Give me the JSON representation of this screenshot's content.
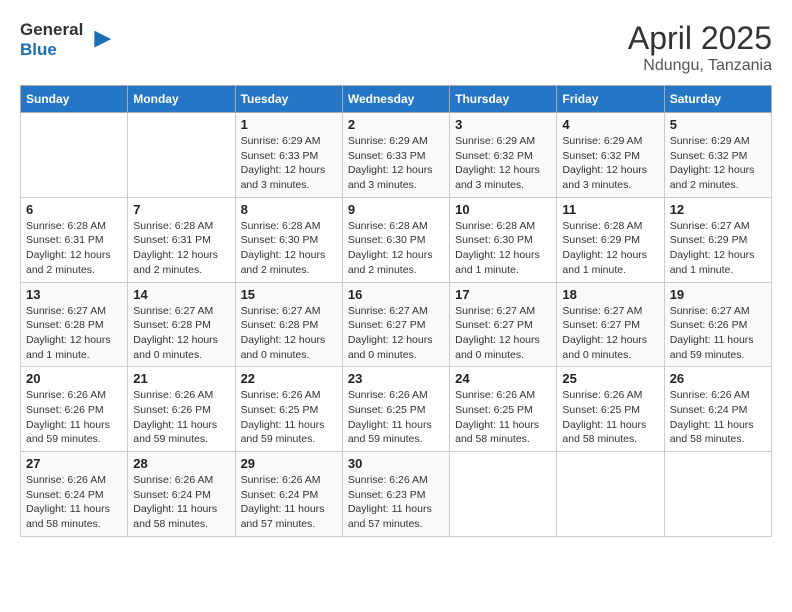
{
  "logo": {
    "general": "General",
    "blue": "Blue"
  },
  "title": "April 2025",
  "subtitle": "Ndungu, Tanzania",
  "days_of_week": [
    "Sunday",
    "Monday",
    "Tuesday",
    "Wednesday",
    "Thursday",
    "Friday",
    "Saturday"
  ],
  "weeks": [
    [
      {
        "date": "",
        "info": ""
      },
      {
        "date": "",
        "info": ""
      },
      {
        "date": "1",
        "info": "Sunrise: 6:29 AM\nSunset: 6:33 PM\nDaylight: 12 hours and 3 minutes."
      },
      {
        "date": "2",
        "info": "Sunrise: 6:29 AM\nSunset: 6:33 PM\nDaylight: 12 hours and 3 minutes."
      },
      {
        "date": "3",
        "info": "Sunrise: 6:29 AM\nSunset: 6:32 PM\nDaylight: 12 hours and 3 minutes."
      },
      {
        "date": "4",
        "info": "Sunrise: 6:29 AM\nSunset: 6:32 PM\nDaylight: 12 hours and 3 minutes."
      },
      {
        "date": "5",
        "info": "Sunrise: 6:29 AM\nSunset: 6:32 PM\nDaylight: 12 hours and 2 minutes."
      }
    ],
    [
      {
        "date": "6",
        "info": "Sunrise: 6:28 AM\nSunset: 6:31 PM\nDaylight: 12 hours and 2 minutes."
      },
      {
        "date": "7",
        "info": "Sunrise: 6:28 AM\nSunset: 6:31 PM\nDaylight: 12 hours and 2 minutes."
      },
      {
        "date": "8",
        "info": "Sunrise: 6:28 AM\nSunset: 6:30 PM\nDaylight: 12 hours and 2 minutes."
      },
      {
        "date": "9",
        "info": "Sunrise: 6:28 AM\nSunset: 6:30 PM\nDaylight: 12 hours and 2 minutes."
      },
      {
        "date": "10",
        "info": "Sunrise: 6:28 AM\nSunset: 6:30 PM\nDaylight: 12 hours and 1 minute."
      },
      {
        "date": "11",
        "info": "Sunrise: 6:28 AM\nSunset: 6:29 PM\nDaylight: 12 hours and 1 minute."
      },
      {
        "date": "12",
        "info": "Sunrise: 6:27 AM\nSunset: 6:29 PM\nDaylight: 12 hours and 1 minute."
      }
    ],
    [
      {
        "date": "13",
        "info": "Sunrise: 6:27 AM\nSunset: 6:28 PM\nDaylight: 12 hours and 1 minute."
      },
      {
        "date": "14",
        "info": "Sunrise: 6:27 AM\nSunset: 6:28 PM\nDaylight: 12 hours and 0 minutes."
      },
      {
        "date": "15",
        "info": "Sunrise: 6:27 AM\nSunset: 6:28 PM\nDaylight: 12 hours and 0 minutes."
      },
      {
        "date": "16",
        "info": "Sunrise: 6:27 AM\nSunset: 6:27 PM\nDaylight: 12 hours and 0 minutes."
      },
      {
        "date": "17",
        "info": "Sunrise: 6:27 AM\nSunset: 6:27 PM\nDaylight: 12 hours and 0 minutes."
      },
      {
        "date": "18",
        "info": "Sunrise: 6:27 AM\nSunset: 6:27 PM\nDaylight: 12 hours and 0 minutes."
      },
      {
        "date": "19",
        "info": "Sunrise: 6:27 AM\nSunset: 6:26 PM\nDaylight: 11 hours and 59 minutes."
      }
    ],
    [
      {
        "date": "20",
        "info": "Sunrise: 6:26 AM\nSunset: 6:26 PM\nDaylight: 11 hours and 59 minutes."
      },
      {
        "date": "21",
        "info": "Sunrise: 6:26 AM\nSunset: 6:26 PM\nDaylight: 11 hours and 59 minutes."
      },
      {
        "date": "22",
        "info": "Sunrise: 6:26 AM\nSunset: 6:25 PM\nDaylight: 11 hours and 59 minutes."
      },
      {
        "date": "23",
        "info": "Sunrise: 6:26 AM\nSunset: 6:25 PM\nDaylight: 11 hours and 59 minutes."
      },
      {
        "date": "24",
        "info": "Sunrise: 6:26 AM\nSunset: 6:25 PM\nDaylight: 11 hours and 58 minutes."
      },
      {
        "date": "25",
        "info": "Sunrise: 6:26 AM\nSunset: 6:25 PM\nDaylight: 11 hours and 58 minutes."
      },
      {
        "date": "26",
        "info": "Sunrise: 6:26 AM\nSunset: 6:24 PM\nDaylight: 11 hours and 58 minutes."
      }
    ],
    [
      {
        "date": "27",
        "info": "Sunrise: 6:26 AM\nSunset: 6:24 PM\nDaylight: 11 hours and 58 minutes."
      },
      {
        "date": "28",
        "info": "Sunrise: 6:26 AM\nSunset: 6:24 PM\nDaylight: 11 hours and 58 minutes."
      },
      {
        "date": "29",
        "info": "Sunrise: 6:26 AM\nSunset: 6:24 PM\nDaylight: 11 hours and 57 minutes."
      },
      {
        "date": "30",
        "info": "Sunrise: 6:26 AM\nSunset: 6:23 PM\nDaylight: 11 hours and 57 minutes."
      },
      {
        "date": "",
        "info": ""
      },
      {
        "date": "",
        "info": ""
      },
      {
        "date": "",
        "info": ""
      }
    ]
  ]
}
